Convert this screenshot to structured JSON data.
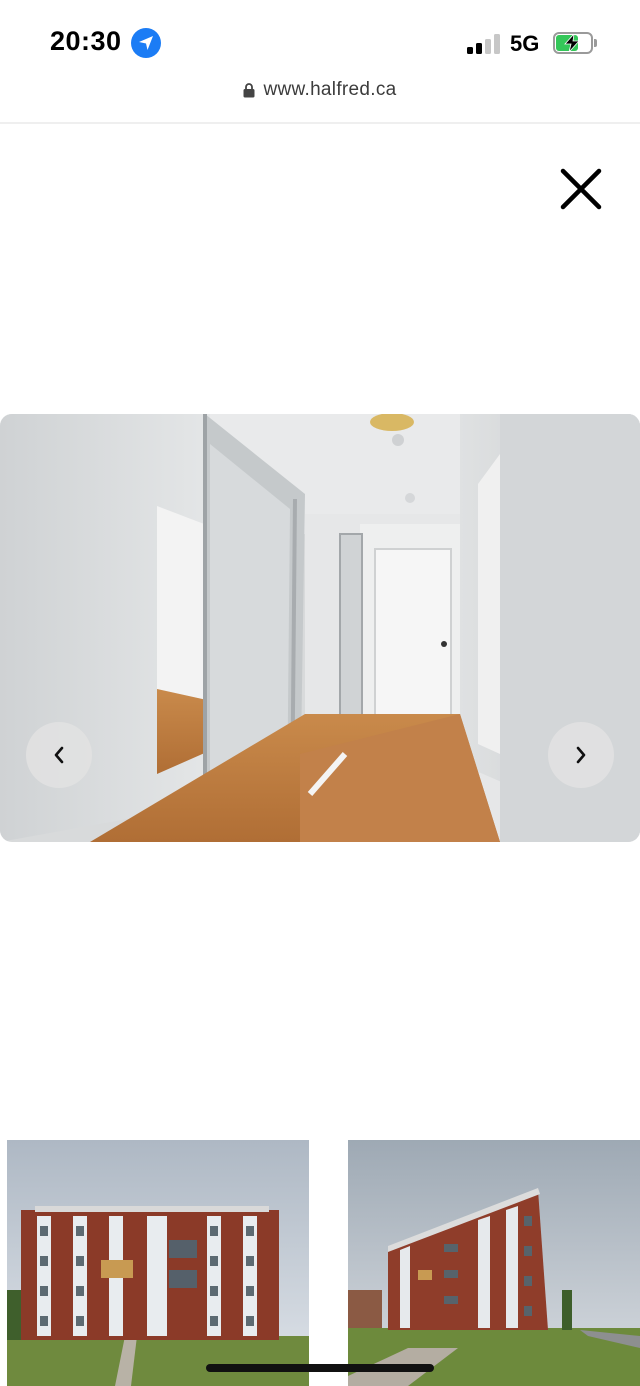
{
  "status_bar": {
    "time": "20:30",
    "network": "5G",
    "icons": [
      "location-arrow-icon",
      "cellular-signal-icon",
      "battery-charging-icon"
    ],
    "signal_bars_filled": 2,
    "signal_bars_total": 4,
    "battery_level": 0.65,
    "accent": "#1b7cf5",
    "battery_color": "#34c759"
  },
  "browser": {
    "url": "www.halfred.ca",
    "lock_icon": "lock-icon"
  },
  "gallery": {
    "close_icon": "close-icon",
    "prev_icon": "chevron-left-icon",
    "next_icon": "chevron-right-icon",
    "main_photo": "apartment-hallway-photo",
    "thumbnails": [
      "building-front-photo",
      "building-side-photo"
    ]
  }
}
